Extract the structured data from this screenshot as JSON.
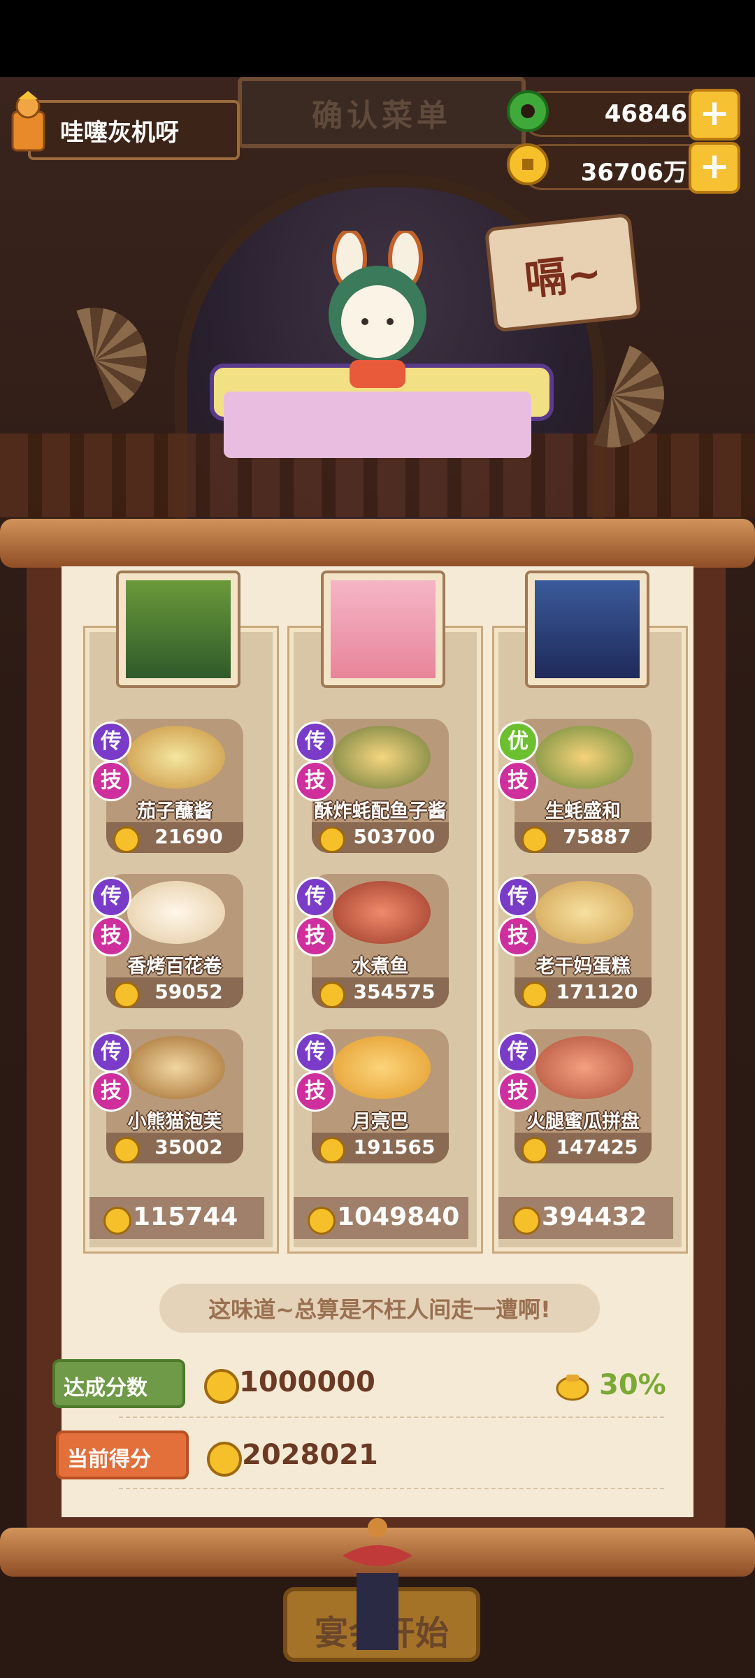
{
  "header": {
    "title_sign": "确认菜单",
    "player_name": "哇噻灰机呀"
  },
  "currencies": [
    {
      "name": "jade",
      "value": "46846",
      "plus": "+"
    },
    {
      "name": "coin",
      "value": "36706万",
      "plus": "+"
    }
  ],
  "scene": {
    "speech_text": "嗝~"
  },
  "columns": [
    {
      "dishes": [
        {
          "badge_top": "传",
          "badge_bottom": "技",
          "name": "茄子蘸酱",
          "score": "21690"
        },
        {
          "badge_top": "传",
          "badge_bottom": "技",
          "name": "香烤百花卷",
          "score": "59052"
        },
        {
          "badge_top": "传",
          "badge_bottom": "技",
          "name": "小熊猫泡芙",
          "score": "35002"
        }
      ],
      "total": "115744"
    },
    {
      "dishes": [
        {
          "badge_top": "传",
          "badge_bottom": "技",
          "name": "酥炸蚝配鱼子酱",
          "score": "503700"
        },
        {
          "badge_top": "传",
          "badge_bottom": "技",
          "name": "水煮鱼",
          "score": "354575"
        },
        {
          "badge_top": "传",
          "badge_bottom": "技",
          "name": "月亮巴",
          "score": "191565"
        }
      ],
      "total": "1049840"
    },
    {
      "dishes": [
        {
          "badge_top": "优",
          "badge_bottom": "技",
          "name": "生蚝盛和",
          "score": "75887"
        },
        {
          "badge_top": "传",
          "badge_bottom": "技",
          "name": "老干妈蛋糕",
          "score": "171120"
        },
        {
          "badge_top": "传",
          "badge_bottom": "技",
          "name": "火腿蜜瓜拼盘",
          "score": "147425"
        }
      ],
      "total": "394432"
    }
  ],
  "quote": "这味道~总算是不枉人间走一遭啊!",
  "target": {
    "label": "达成分数",
    "value": "1000000",
    "bonus": "30%"
  },
  "current": {
    "label": "当前得分",
    "value": "2028021"
  },
  "start_button": "宴会开始",
  "colors": {
    "legend_badge": "#7a3cc8",
    "skill_badge": "#cf2f9d",
    "excellent_badge": "#6cbf2f",
    "coin": "#f5c02a"
  }
}
